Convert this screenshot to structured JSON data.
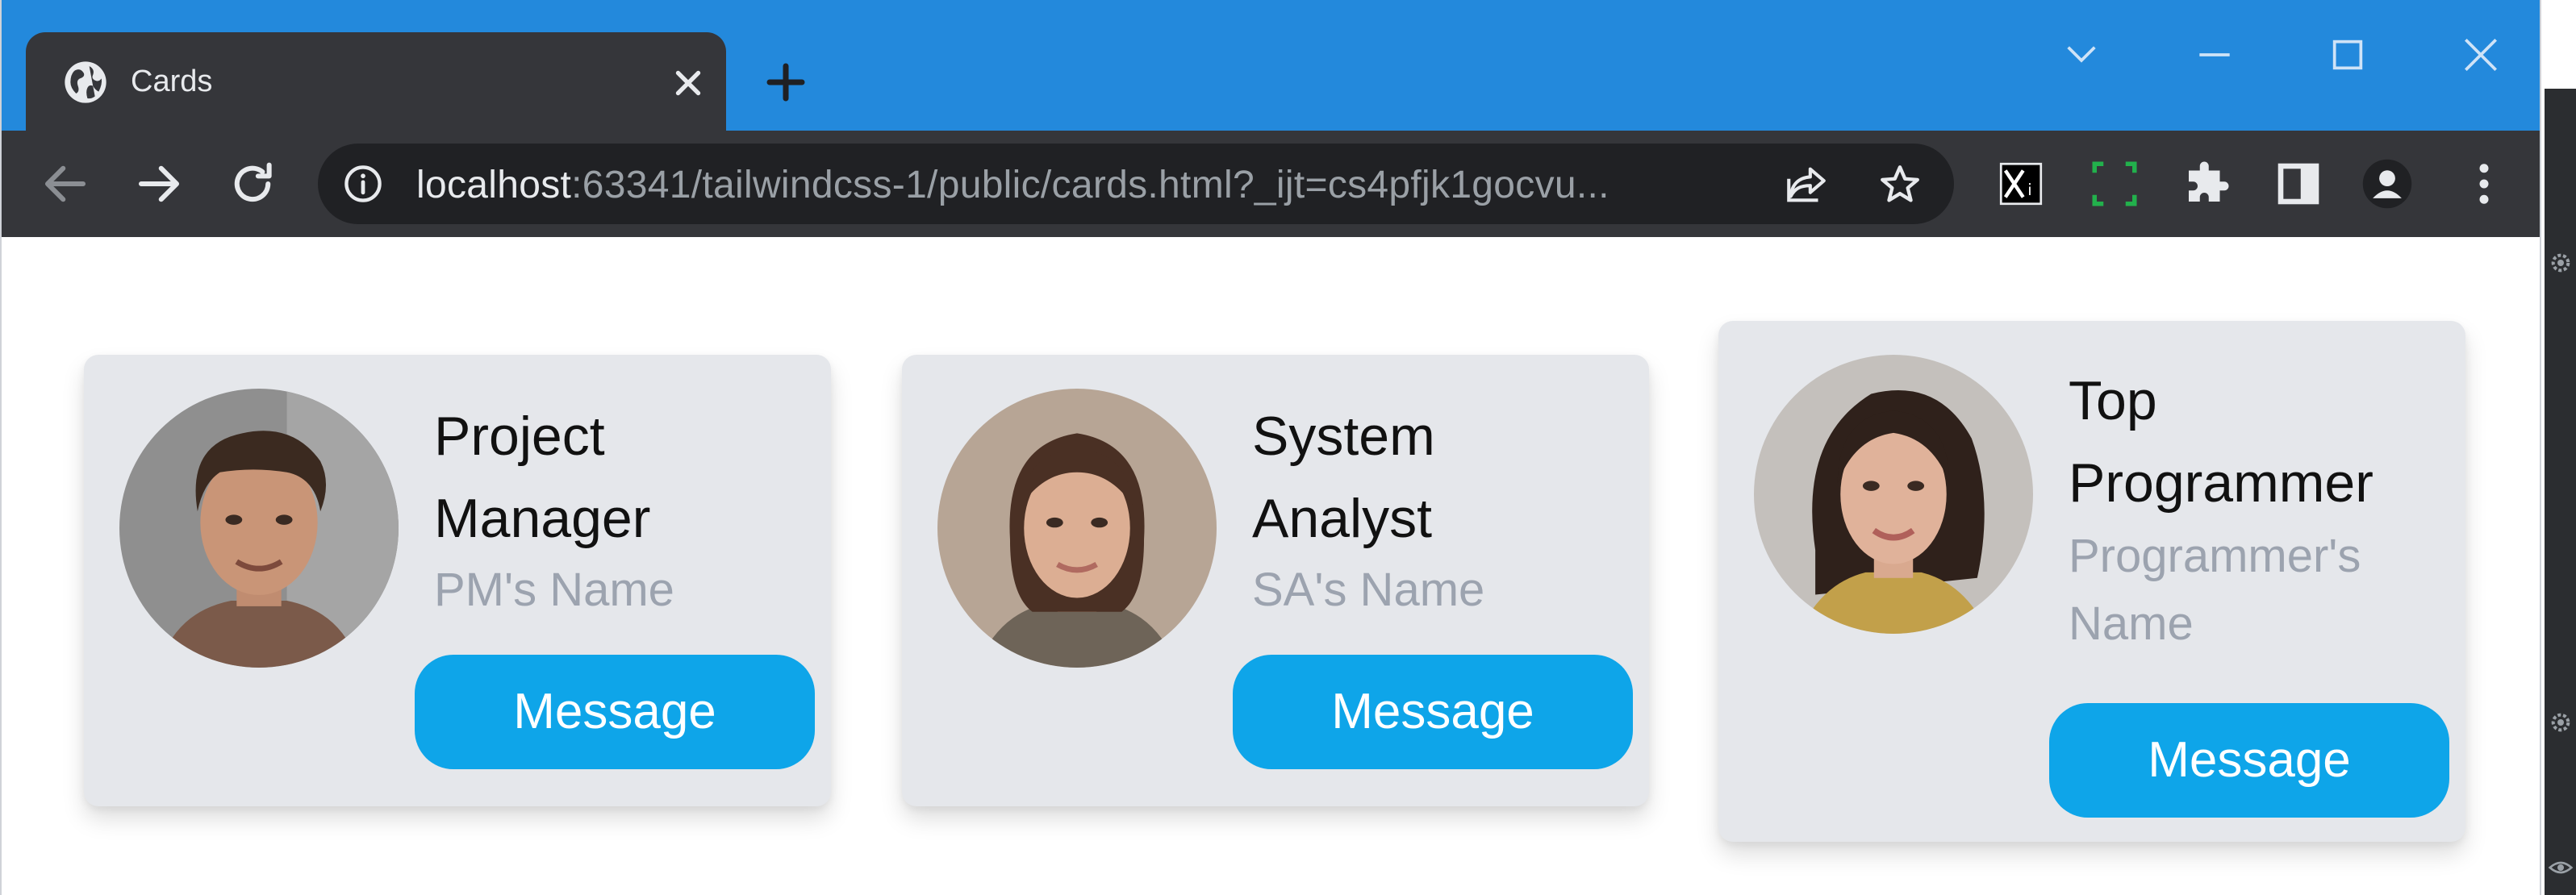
{
  "browser": {
    "tab": {
      "title": "Cards",
      "favicon": "globe-icon",
      "close": "close-icon"
    },
    "new_tab": "plus-icon",
    "window_controls": [
      "chevron-down-icon",
      "minimize-icon",
      "maximize-icon",
      "close-icon"
    ],
    "nav": {
      "back": "arrow-left-icon",
      "forward": "arrow-right-icon",
      "reload": "reload-icon"
    },
    "address_bar": {
      "info_icon": "info-icon",
      "url_host": "localhost",
      "url_rest": ":63341/tailwindcss-1/public/cards.html?_ijt=cs4pfjk1gocvu...",
      "share_icon": "share-icon",
      "star_icon": "star-icon"
    },
    "extensions": [
      "xi-extension-icon",
      "frame-extension-icon",
      "puzzle-icon",
      "side-panel-icon",
      "profile-avatar-icon",
      "kebab-menu-icon"
    ]
  },
  "cards": [
    {
      "title_line1": "Project",
      "title_line2": "Manager",
      "name_line1": "PM's Name",
      "name_line2": "",
      "button": "Message",
      "avatar": "man-portrait"
    },
    {
      "title_line1": "System",
      "title_line2": "Analyst",
      "name_line1": "SA's Name",
      "name_line2": "",
      "button": "Message",
      "avatar": "woman-portrait-1"
    },
    {
      "title_line1": "Top",
      "title_line2": "Programmer",
      "name_line1": "Programmer's",
      "name_line2": "Name",
      "button": "Message",
      "avatar": "woman-portrait-2"
    }
  ],
  "colors": {
    "titlebar": "#2389dc",
    "tab": "#35363a",
    "card_bg": "#e5e7eb",
    "button": "#0ea5e9",
    "subtitle": "#9ca3af"
  }
}
